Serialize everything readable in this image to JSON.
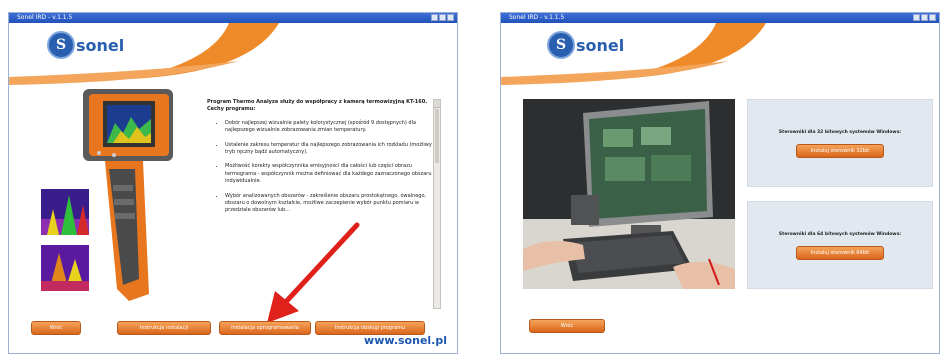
{
  "window1": {
    "title": "Sonel IRD - v.1.1.5",
    "logo_text": "sonel",
    "intro": "Program Thermo Analyze służy do współpracy z kamerą termowizyjną KT-160. Cechy programu:",
    "features": [
      "Dobór najlepszej wizualnie palety kolorystycznej (spośród 9 dostępnych) dla najlepszego wizualnie zobrazowania zmian temperatury.",
      "Ustalenie zakresu temperatur dla najlepszego zobrazowania ich rozkładu (możliwy tryb ręczny bądź automatyczny).",
      "Możliwość korekty współczynnika emisyjności dla całości lub części obrazu termograma - współczynnik można definiować dla każdego zaznaczonego obszaru indywidualnie.",
      "Wybór analizowanych obszarów - zakreślenie obszaru prostokątnego, owalnego, obszaru o dowolnym kształcie, możliwe zaczepienie wybór punktu pomiaru w przedziale obszarów lub..."
    ],
    "buttons": [
      "Wróć",
      "Instrukcja instalacji",
      "Instalacja oprogramowania",
      "Instrukcja obsługi programu"
    ],
    "url": "www.sonel.pl"
  },
  "window2": {
    "title": "Sonel IRD - v.1.1.5",
    "logo_text": "sonel",
    "panel1_text": "Sterowniki dla 32 bitowych systemów Windows:",
    "panel1_button": "Instaluj sterownik 32bit",
    "panel2_text": "Sterowniki dla 64 bitowych systemów Windows:",
    "panel2_button": "Instaluj sterownik 64bit",
    "back_button": "Wróć"
  },
  "colors": {
    "orange": "#e8761e",
    "blue": "#2a5fb0",
    "titlebar": "#2152b8",
    "arrow": "#e0201a"
  }
}
